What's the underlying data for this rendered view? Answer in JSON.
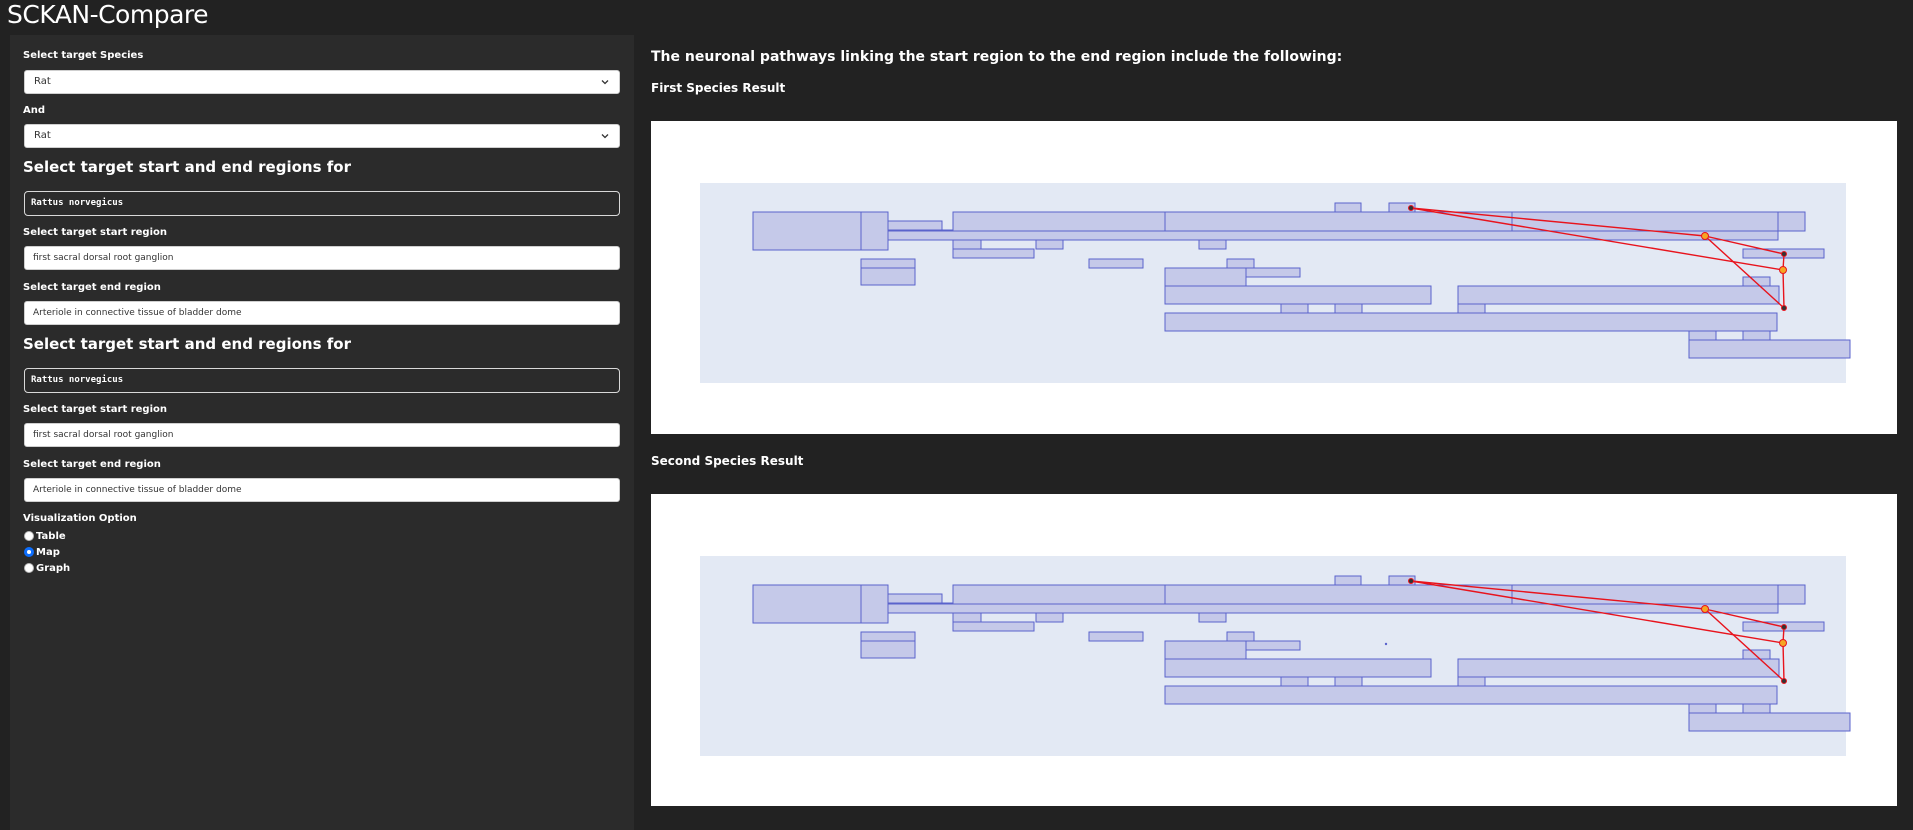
{
  "app": {
    "title": "SCKAN-Compare"
  },
  "sidebar": {
    "species_label": "Select target Species",
    "species_value": "Rat",
    "and_label": "And",
    "species2_value": "Rat",
    "section1": {
      "heading": "Select target start and end regions for",
      "species_code": "Rattus norvegicus",
      "start_label": "Select target start region",
      "start_value": "first sacral dorsal root ganglion",
      "end_label": "Select target end region",
      "end_value": "Arteriole in connective tissue of bladder dome"
    },
    "section2": {
      "heading": "Select target start and end regions for",
      "species_code": "Rattus norvegicus",
      "start_label": "Select target start region",
      "start_value": "first sacral dorsal root ganglion",
      "end_label": "Select target end region",
      "end_value": "Arteriole in connective tissue of bladder dome"
    },
    "viz_label": "Visualization Option",
    "viz_options": [
      "Table",
      "Map",
      "Graph"
    ],
    "viz_selected": "Map"
  },
  "main": {
    "heading": "The neuronal pathways linking the start region to the end region include the following:",
    "first_result_label": "First Species Result",
    "second_result_label": "Second Species Result"
  },
  "colors": {
    "region_fill": "#c5c9e9",
    "region_stroke": "#5a63cc",
    "map_bg": "#e3e9f4",
    "path_line": "#e8131c",
    "node_orange": "#f5a623"
  },
  "icons": {
    "select_arrow": "chevron-down-icon"
  }
}
